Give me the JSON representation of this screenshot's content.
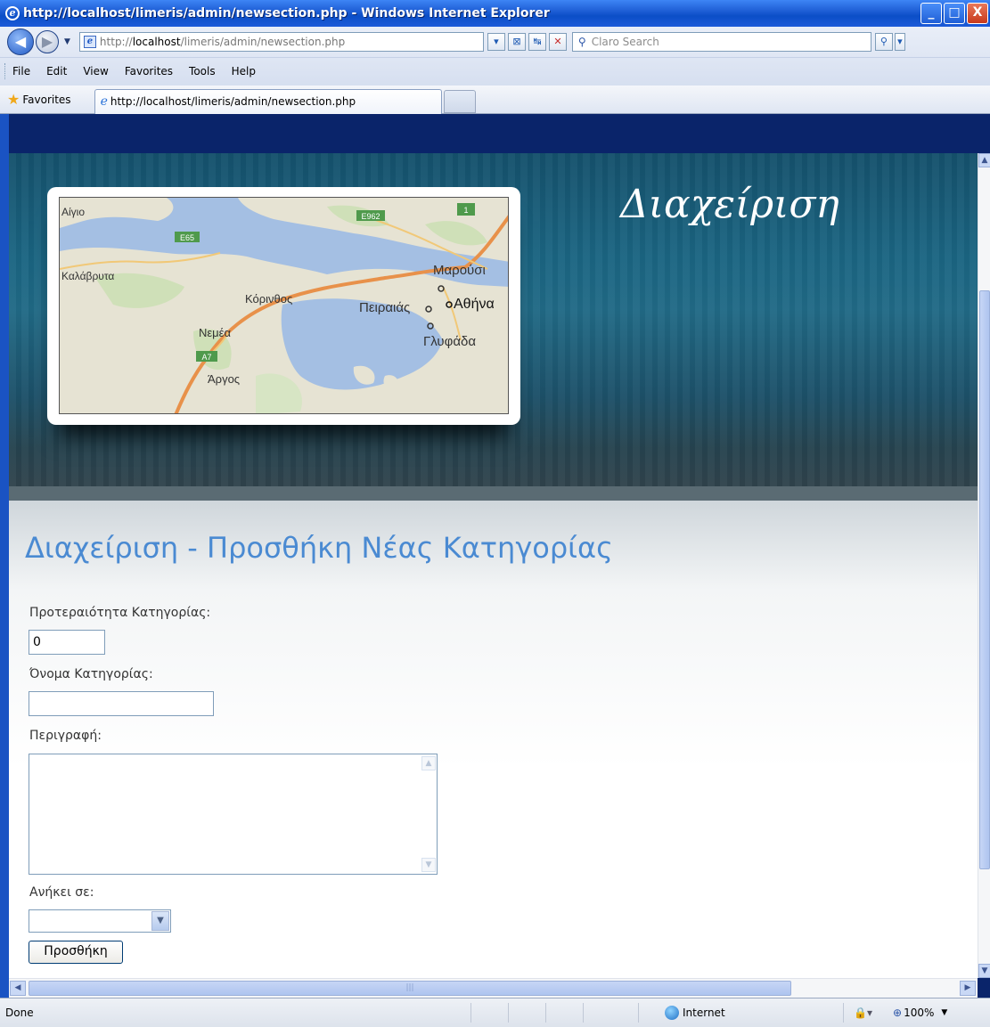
{
  "window": {
    "title": "http://localhost/limeris/admin/newsection.php - Windows Internet Explorer",
    "controls": {
      "minimize": "_",
      "maximize": "□",
      "close": "X"
    }
  },
  "navbar": {
    "back_icon": "back-arrow-icon",
    "forward_icon": "forward-arrow-icon",
    "address_prefix": "http://",
    "address_host": "localhost",
    "address_path": "/limeris/admin/newsection.php",
    "search_placeholder": "Claro Search"
  },
  "menu": {
    "items": [
      "File",
      "Edit",
      "View",
      "Favorites",
      "Tools",
      "Help"
    ]
  },
  "favbar": {
    "favorites_label": "Favorites",
    "tab_title": "http://localhost/limeris/admin/newsection.php"
  },
  "banner": {
    "brand": "Διαχείριση",
    "map_labels": [
      {
        "name": "Αίγιο"
      },
      {
        "name": "Καλάβρυτα"
      },
      {
        "name": "Κόρινθος"
      },
      {
        "name": "Νεμέα"
      },
      {
        "name": "Άργος"
      },
      {
        "name": "Πειραιάς"
      },
      {
        "name": "Αθήνα"
      },
      {
        "name": "Μαρούσι"
      },
      {
        "name": "Γλυφάδα"
      }
    ],
    "road_badges": [
      "E962",
      "E65",
      "A7",
      "1"
    ]
  },
  "form": {
    "heading": "Διαχείριση - Προσθήκη Νέας Κατηγορίας",
    "priority_label": "Προτεραιότητα Κατηγορίας:",
    "priority_value": "0",
    "name_label": "Όνομα Κατηγορίας:",
    "name_value": "",
    "description_label": "Περιγραφή:",
    "description_value": "",
    "parent_label": "Ανήκει σε:",
    "parent_selected": "",
    "submit_label": "Προσθήκη"
  },
  "statusbar": {
    "status": "Done",
    "zone": "Internet",
    "zoom": "100%"
  }
}
